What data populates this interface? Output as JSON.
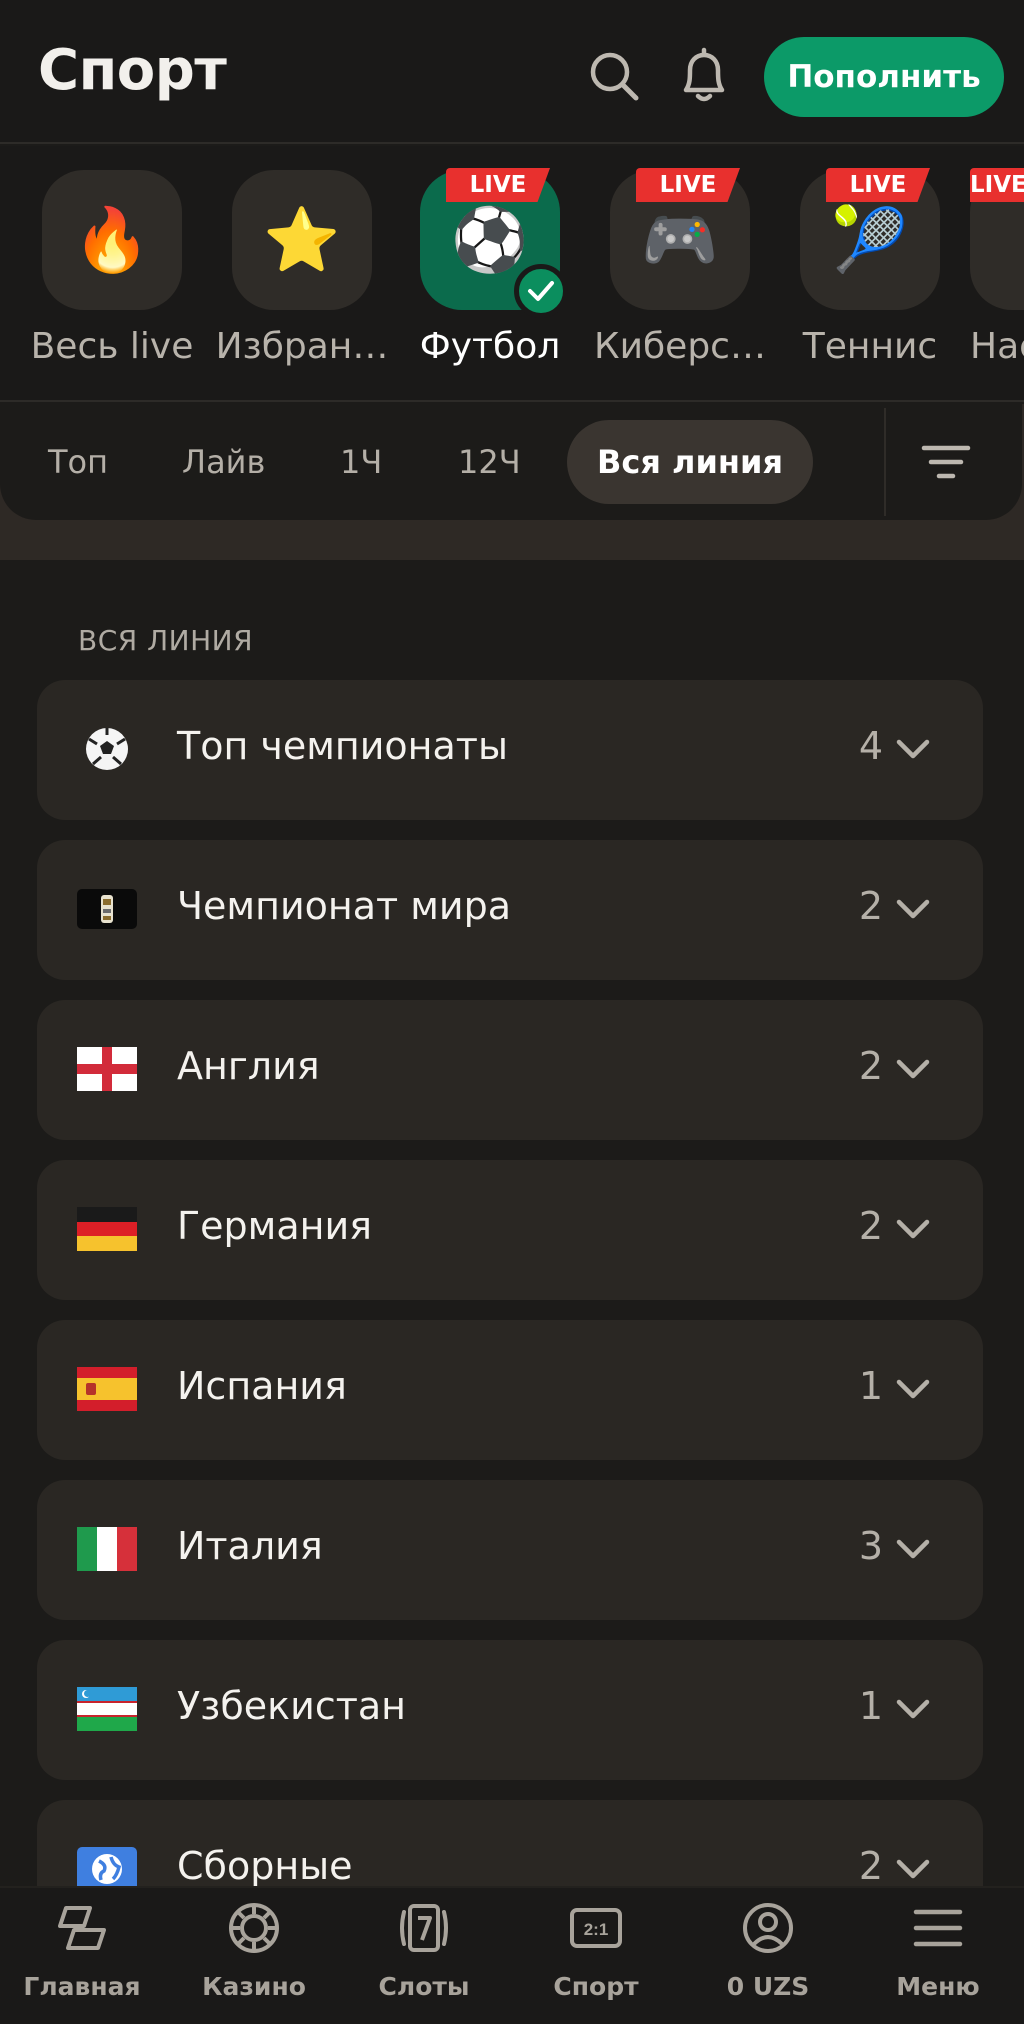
{
  "header": {
    "title": "Спорт",
    "topup_label": "Пополнить"
  },
  "sports": [
    {
      "label": "Весь live",
      "emoji": "🔥",
      "live": false,
      "active": false
    },
    {
      "label": "Избран…",
      "emoji": "⭐",
      "live": false,
      "active": false
    },
    {
      "label": "Футбол",
      "emoji": "⚽",
      "live": true,
      "active": true
    },
    {
      "label": "Киберс…",
      "emoji": "🎮",
      "live": true,
      "active": false
    },
    {
      "label": "Теннис",
      "emoji": "🎾",
      "live": true,
      "active": false
    },
    {
      "label": "Нас",
      "emoji": "",
      "live": true,
      "active": false
    }
  ],
  "live_badge": "LIVE",
  "filters": {
    "tabs": [
      "Топ",
      "Лайв",
      "1Ч",
      "12Ч",
      "Вся линия"
    ],
    "active": "Вся линия"
  },
  "section_label": "ВСЯ ЛИНИЯ",
  "rows": [
    {
      "label": "Топ чемпионаты",
      "count": "4",
      "icon": "soccer-ball-icon"
    },
    {
      "label": "Чемпионат мира",
      "count": "2",
      "icon": "world-cup-logo-icon"
    },
    {
      "label": "Англия",
      "count": "2",
      "icon": "england-flag-icon"
    },
    {
      "label": "Германия",
      "count": "2",
      "icon": "germany-flag-icon"
    },
    {
      "label": "Испания",
      "count": "1",
      "icon": "spain-flag-icon"
    },
    {
      "label": "Италия",
      "count": "3",
      "icon": "italy-flag-icon"
    },
    {
      "label": "Узбекистан",
      "count": "1",
      "icon": "uzbekistan-flag-icon"
    },
    {
      "label": "Сборные",
      "count": "2",
      "icon": "globe-icon"
    }
  ],
  "bottom_nav": [
    {
      "label": "Главная",
      "icon": "home-icon"
    },
    {
      "label": "Казино",
      "icon": "casino-chip-icon"
    },
    {
      "label": "Слоты",
      "icon": "slots-icon"
    },
    {
      "label": "Спорт",
      "icon": "sport-score-icon"
    },
    {
      "label": "0 UZS",
      "icon": "account-icon"
    },
    {
      "label": "Меню",
      "icon": "menu-icon"
    }
  ],
  "colors": {
    "accent": "#0c9a68",
    "live": "#e8302e",
    "background": "#1c1b19",
    "card": "#2a2723"
  }
}
